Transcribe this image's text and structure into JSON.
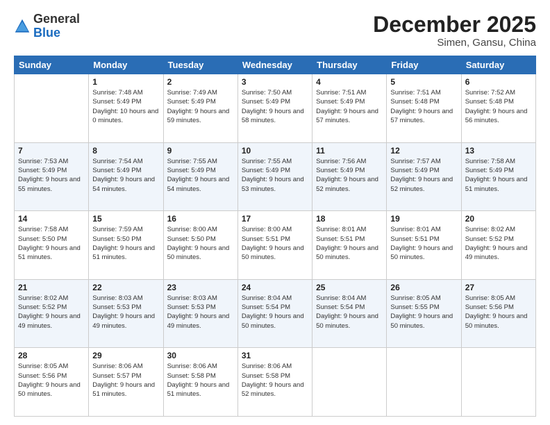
{
  "header": {
    "logo_general": "General",
    "logo_blue": "Blue",
    "month": "December 2025",
    "location": "Simen, Gansu, China"
  },
  "weekdays": [
    "Sunday",
    "Monday",
    "Tuesday",
    "Wednesday",
    "Thursday",
    "Friday",
    "Saturday"
  ],
  "weeks": [
    [
      {
        "day": "",
        "sunrise": "",
        "sunset": "",
        "daylight": ""
      },
      {
        "day": "1",
        "sunrise": "Sunrise: 7:48 AM",
        "sunset": "Sunset: 5:49 PM",
        "daylight": "Daylight: 10 hours and 0 minutes."
      },
      {
        "day": "2",
        "sunrise": "Sunrise: 7:49 AM",
        "sunset": "Sunset: 5:49 PM",
        "daylight": "Daylight: 9 hours and 59 minutes."
      },
      {
        "day": "3",
        "sunrise": "Sunrise: 7:50 AM",
        "sunset": "Sunset: 5:49 PM",
        "daylight": "Daylight: 9 hours and 58 minutes."
      },
      {
        "day": "4",
        "sunrise": "Sunrise: 7:51 AM",
        "sunset": "Sunset: 5:49 PM",
        "daylight": "Daylight: 9 hours and 57 minutes."
      },
      {
        "day": "5",
        "sunrise": "Sunrise: 7:51 AM",
        "sunset": "Sunset: 5:48 PM",
        "daylight": "Daylight: 9 hours and 57 minutes."
      },
      {
        "day": "6",
        "sunrise": "Sunrise: 7:52 AM",
        "sunset": "Sunset: 5:48 PM",
        "daylight": "Daylight: 9 hours and 56 minutes."
      }
    ],
    [
      {
        "day": "7",
        "sunrise": "Sunrise: 7:53 AM",
        "sunset": "Sunset: 5:49 PM",
        "daylight": "Daylight: 9 hours and 55 minutes."
      },
      {
        "day": "8",
        "sunrise": "Sunrise: 7:54 AM",
        "sunset": "Sunset: 5:49 PM",
        "daylight": "Daylight: 9 hours and 54 minutes."
      },
      {
        "day": "9",
        "sunrise": "Sunrise: 7:55 AM",
        "sunset": "Sunset: 5:49 PM",
        "daylight": "Daylight: 9 hours and 54 minutes."
      },
      {
        "day": "10",
        "sunrise": "Sunrise: 7:55 AM",
        "sunset": "Sunset: 5:49 PM",
        "daylight": "Daylight: 9 hours and 53 minutes."
      },
      {
        "day": "11",
        "sunrise": "Sunrise: 7:56 AM",
        "sunset": "Sunset: 5:49 PM",
        "daylight": "Daylight: 9 hours and 52 minutes."
      },
      {
        "day": "12",
        "sunrise": "Sunrise: 7:57 AM",
        "sunset": "Sunset: 5:49 PM",
        "daylight": "Daylight: 9 hours and 52 minutes."
      },
      {
        "day": "13",
        "sunrise": "Sunrise: 7:58 AM",
        "sunset": "Sunset: 5:49 PM",
        "daylight": "Daylight: 9 hours and 51 minutes."
      }
    ],
    [
      {
        "day": "14",
        "sunrise": "Sunrise: 7:58 AM",
        "sunset": "Sunset: 5:50 PM",
        "daylight": "Daylight: 9 hours and 51 minutes."
      },
      {
        "day": "15",
        "sunrise": "Sunrise: 7:59 AM",
        "sunset": "Sunset: 5:50 PM",
        "daylight": "Daylight: 9 hours and 51 minutes."
      },
      {
        "day": "16",
        "sunrise": "Sunrise: 8:00 AM",
        "sunset": "Sunset: 5:50 PM",
        "daylight": "Daylight: 9 hours and 50 minutes."
      },
      {
        "day": "17",
        "sunrise": "Sunrise: 8:00 AM",
        "sunset": "Sunset: 5:51 PM",
        "daylight": "Daylight: 9 hours and 50 minutes."
      },
      {
        "day": "18",
        "sunrise": "Sunrise: 8:01 AM",
        "sunset": "Sunset: 5:51 PM",
        "daylight": "Daylight: 9 hours and 50 minutes."
      },
      {
        "day": "19",
        "sunrise": "Sunrise: 8:01 AM",
        "sunset": "Sunset: 5:51 PM",
        "daylight": "Daylight: 9 hours and 50 minutes."
      },
      {
        "day": "20",
        "sunrise": "Sunrise: 8:02 AM",
        "sunset": "Sunset: 5:52 PM",
        "daylight": "Daylight: 9 hours and 49 minutes."
      }
    ],
    [
      {
        "day": "21",
        "sunrise": "Sunrise: 8:02 AM",
        "sunset": "Sunset: 5:52 PM",
        "daylight": "Daylight: 9 hours and 49 minutes."
      },
      {
        "day": "22",
        "sunrise": "Sunrise: 8:03 AM",
        "sunset": "Sunset: 5:53 PM",
        "daylight": "Daylight: 9 hours and 49 minutes."
      },
      {
        "day": "23",
        "sunrise": "Sunrise: 8:03 AM",
        "sunset": "Sunset: 5:53 PM",
        "daylight": "Daylight: 9 hours and 49 minutes."
      },
      {
        "day": "24",
        "sunrise": "Sunrise: 8:04 AM",
        "sunset": "Sunset: 5:54 PM",
        "daylight": "Daylight: 9 hours and 50 minutes."
      },
      {
        "day": "25",
        "sunrise": "Sunrise: 8:04 AM",
        "sunset": "Sunset: 5:54 PM",
        "daylight": "Daylight: 9 hours and 50 minutes."
      },
      {
        "day": "26",
        "sunrise": "Sunrise: 8:05 AM",
        "sunset": "Sunset: 5:55 PM",
        "daylight": "Daylight: 9 hours and 50 minutes."
      },
      {
        "day": "27",
        "sunrise": "Sunrise: 8:05 AM",
        "sunset": "Sunset: 5:56 PM",
        "daylight": "Daylight: 9 hours and 50 minutes."
      }
    ],
    [
      {
        "day": "28",
        "sunrise": "Sunrise: 8:05 AM",
        "sunset": "Sunset: 5:56 PM",
        "daylight": "Daylight: 9 hours and 50 minutes."
      },
      {
        "day": "29",
        "sunrise": "Sunrise: 8:06 AM",
        "sunset": "Sunset: 5:57 PM",
        "daylight": "Daylight: 9 hours and 51 minutes."
      },
      {
        "day": "30",
        "sunrise": "Sunrise: 8:06 AM",
        "sunset": "Sunset: 5:58 PM",
        "daylight": "Daylight: 9 hours and 51 minutes."
      },
      {
        "day": "31",
        "sunrise": "Sunrise: 8:06 AM",
        "sunset": "Sunset: 5:58 PM",
        "daylight": "Daylight: 9 hours and 52 minutes."
      },
      {
        "day": "",
        "sunrise": "",
        "sunset": "",
        "daylight": ""
      },
      {
        "day": "",
        "sunrise": "",
        "sunset": "",
        "daylight": ""
      },
      {
        "day": "",
        "sunrise": "",
        "sunset": "",
        "daylight": ""
      }
    ]
  ]
}
